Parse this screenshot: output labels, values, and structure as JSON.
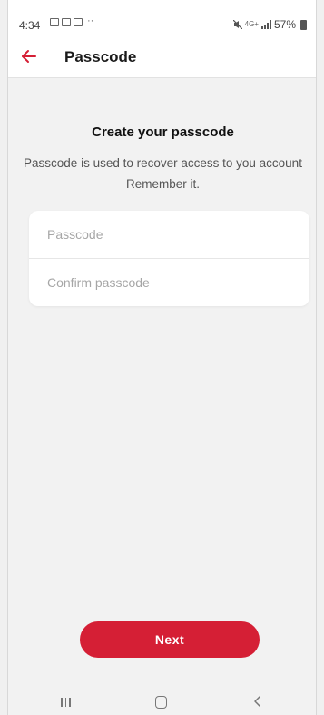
{
  "status_bar": {
    "time": "4:34",
    "network": "4G+",
    "battery": "57%",
    "notification_icons": [
      "gallery-icon",
      "gallery-icon",
      "person-icon"
    ],
    "more_indicator": "··"
  },
  "app_bar": {
    "title": "Passcode",
    "back_icon": "arrow-left-icon"
  },
  "content": {
    "heading": "Create your passcode",
    "description_line1": "Passcode is used to recover access to you account",
    "description_line2": "Remember it."
  },
  "form": {
    "passcode_placeholder": "Passcode",
    "passcode_value": "",
    "confirm_placeholder": "Confirm passcode",
    "confirm_value": ""
  },
  "actions": {
    "next_label": "Next"
  },
  "navigation_bar": {
    "icons": [
      "recent-apps-icon",
      "home-icon",
      "back-icon"
    ]
  },
  "colors": {
    "accent": "#d51f35",
    "background": "#f2f2f2",
    "surface": "#ffffff"
  }
}
